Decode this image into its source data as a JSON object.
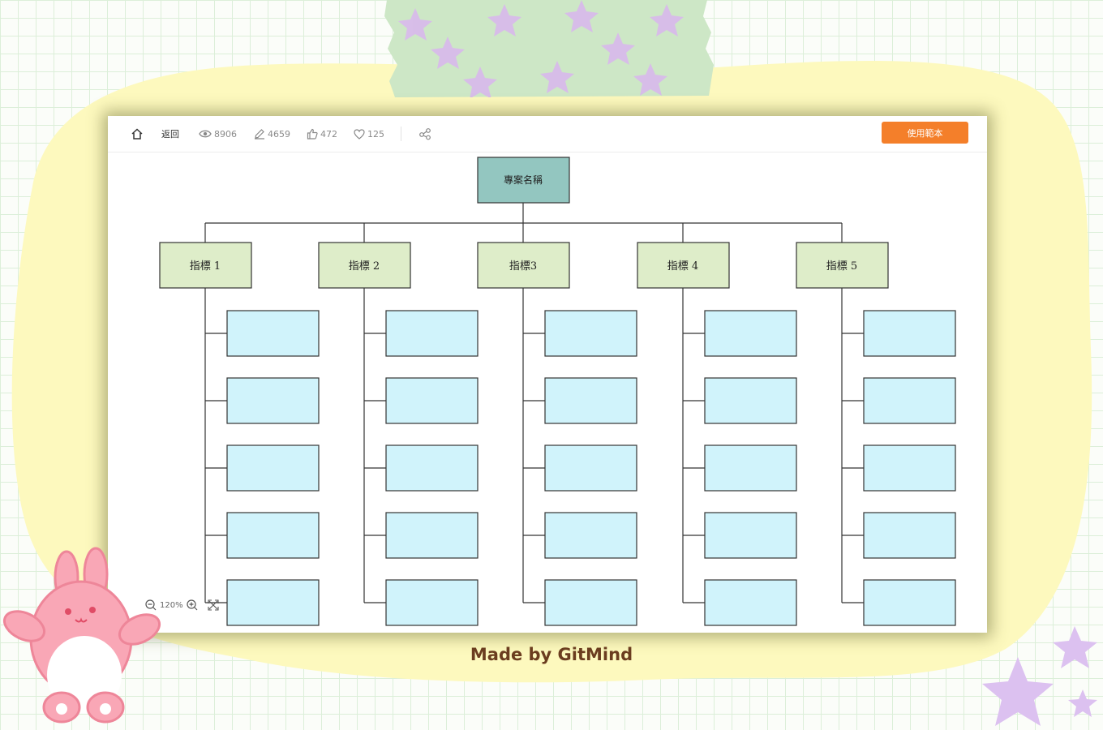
{
  "toolbar": {
    "back_label": "返回",
    "views": "8906",
    "edits": "4659",
    "likes": "472",
    "favorites": "125",
    "use_template_label": "使用範本"
  },
  "diagram": {
    "root": "專案名稱",
    "columns": [
      {
        "label": "指標 1"
      },
      {
        "label": "指標 2"
      },
      {
        "label": "指標3"
      },
      {
        "label": "指標 4"
      },
      {
        "label": "指標 5"
      }
    ],
    "child_rows": 5,
    "colors": {
      "root": "#93c6c0",
      "branch": "#deedc9",
      "leaf": "#d0f3fb",
      "accent": "#f47f2a"
    }
  },
  "zoom": {
    "level": "120%"
  },
  "footer": {
    "text": "Made by GitMind"
  }
}
